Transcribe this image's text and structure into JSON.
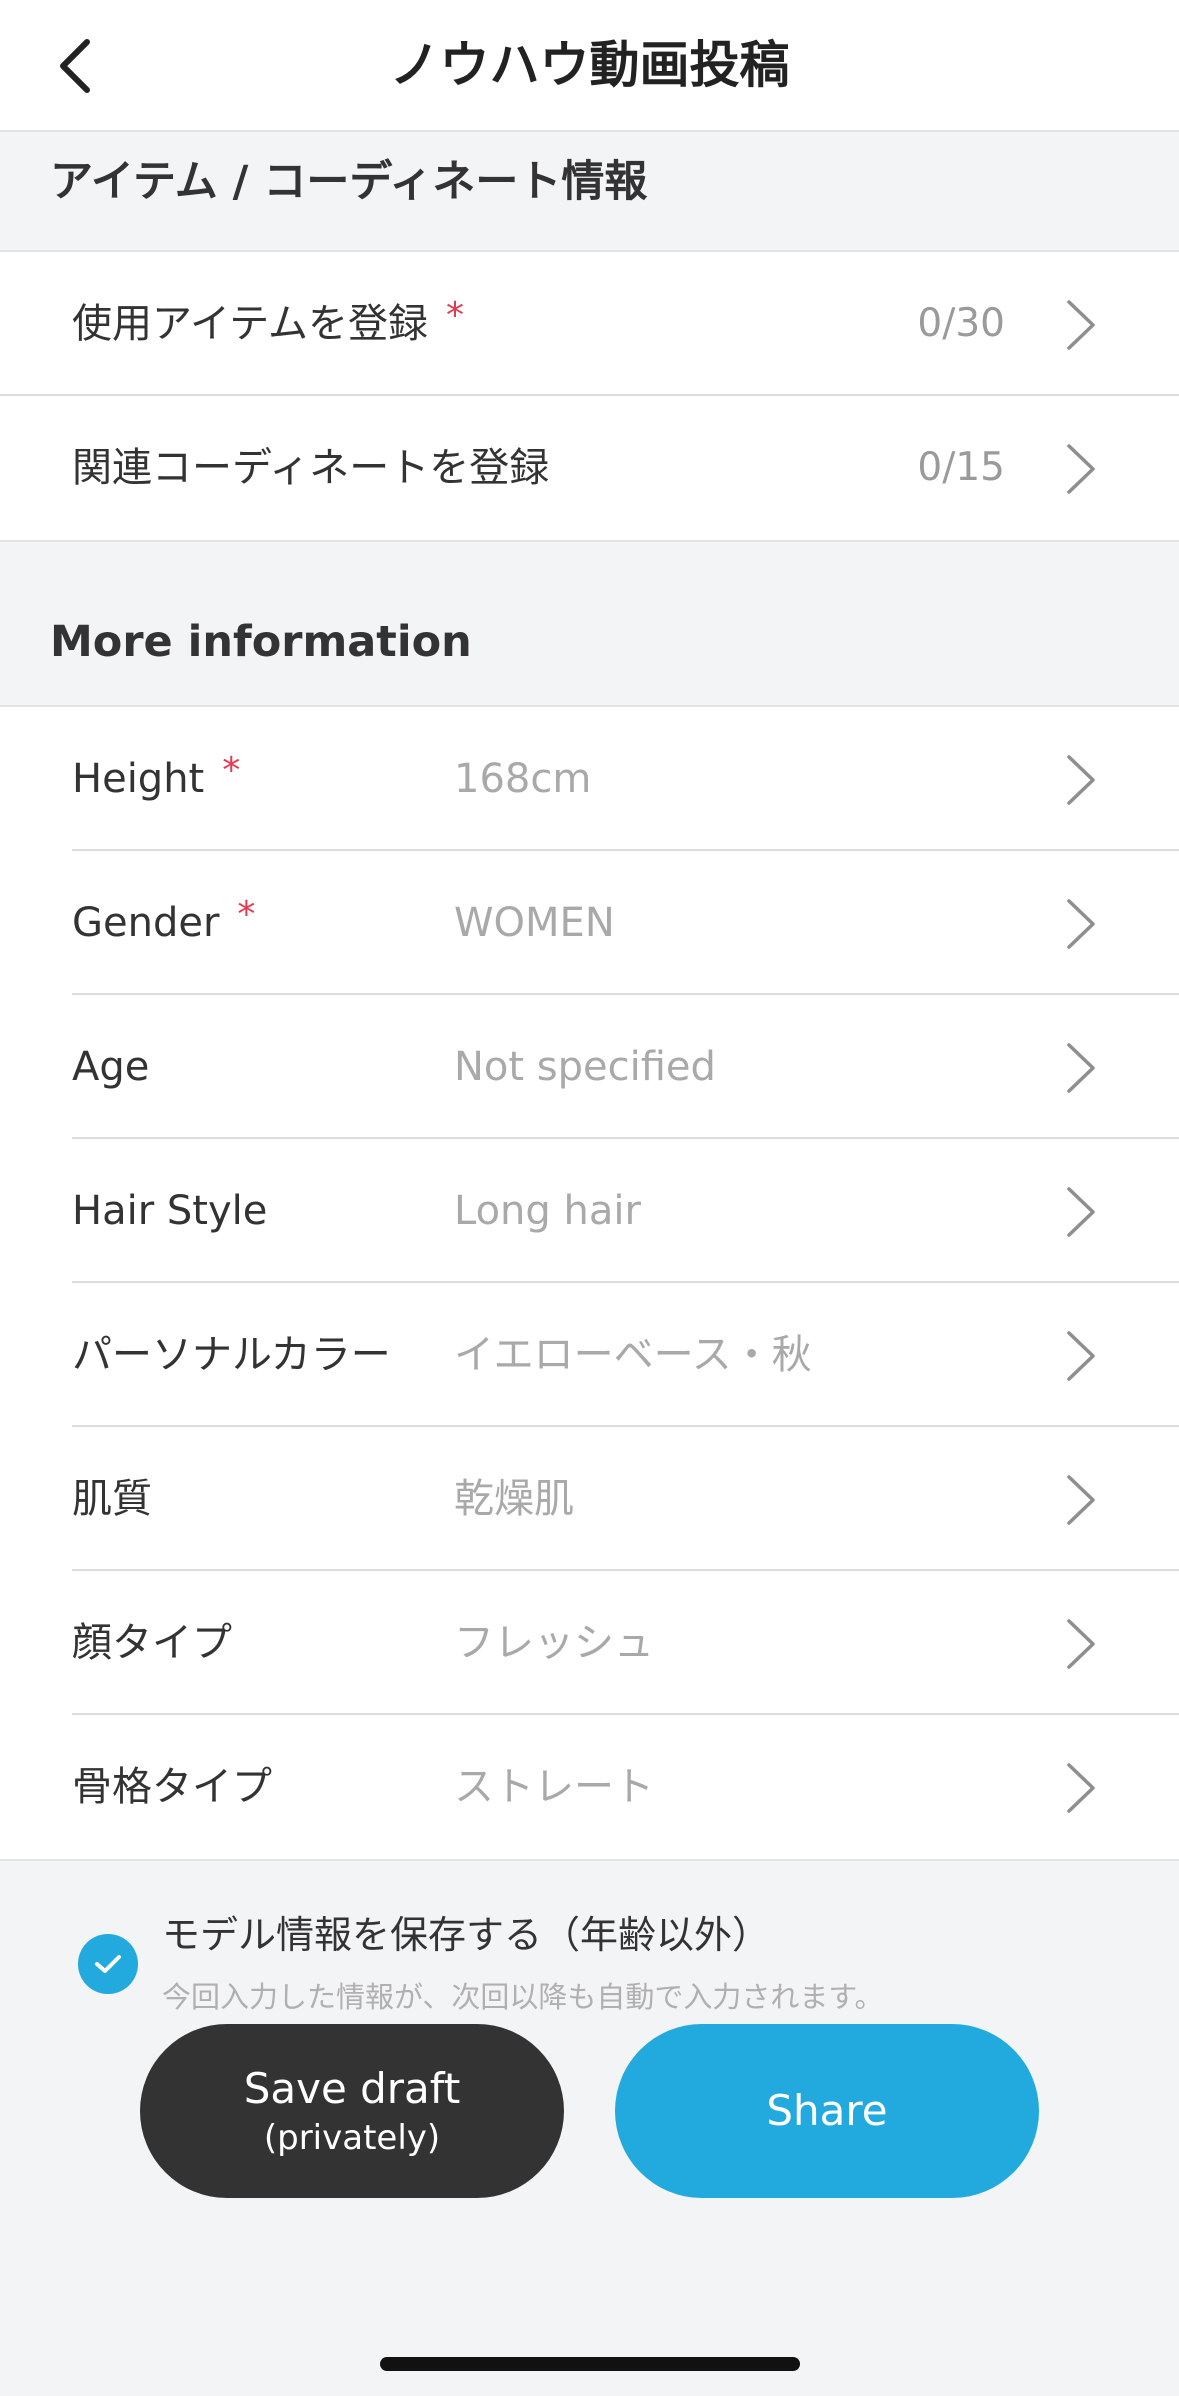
{
  "header": {
    "title": "ノウハウ動画投稿"
  },
  "section_items": {
    "title": "アイテム / コーディネート情報",
    "rows": [
      {
        "label": "使用アイテムを登録",
        "required": "*",
        "count": "0/30"
      },
      {
        "label": "関連コーディネートを登録",
        "count": "0/15"
      }
    ]
  },
  "section_more": {
    "title": "More information",
    "rows": [
      {
        "label": "Height",
        "required": "*",
        "value": "168cm"
      },
      {
        "label": "Gender",
        "required": "*",
        "value": "WOMEN"
      },
      {
        "label": "Age",
        "value": "Not specified"
      },
      {
        "label": "Hair Style",
        "value": "Long hair"
      },
      {
        "label": "パーソナルカラー",
        "value": "イエローベース・秋"
      },
      {
        "label": "肌質",
        "value": "乾燥肌"
      },
      {
        "label": "顔タイプ",
        "value": "フレッシュ"
      },
      {
        "label": "骨格タイプ",
        "value": "ストレート"
      }
    ]
  },
  "save_model": {
    "checked": true,
    "title": "モデル情報を保存する（年齢以外）",
    "subtitle": "今回入力した情報が、次回以降も自動で入力されます。"
  },
  "buttons": {
    "draft_label": "Save draft",
    "draft_sub": "(privately)",
    "share_label": "Share"
  },
  "colors": {
    "accent": "#22a9de",
    "required": "#e53950",
    "dark_button": "#333333"
  }
}
